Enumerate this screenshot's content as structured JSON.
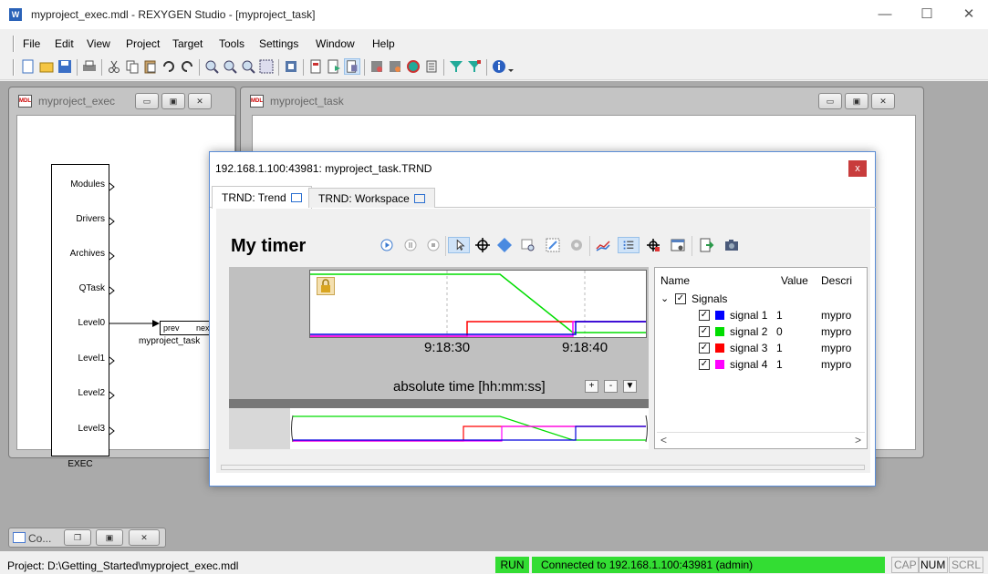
{
  "window": {
    "title": "myproject_exec.mdl - REXYGEN Studio - [myproject_task]",
    "icon_letter": "W",
    "controls": [
      "—",
      "☐",
      "✕"
    ]
  },
  "menubar": [
    "File",
    "Edit",
    "View",
    "Project",
    "Target",
    "Tools",
    "Settings",
    "Window",
    "Help"
  ],
  "toolbar": {
    "icons": [
      "new-file-icon",
      "open-folder-icon",
      "save-icon",
      "print-icon",
      "cut-icon",
      "copy-icon",
      "paste-icon",
      "undo-icon",
      "redo-icon",
      "zoom-in-icon",
      "zoom-out-icon",
      "zoom-fit-icon",
      "zoom-window-icon",
      "compile-icon",
      "block-props-icon",
      "download-icon",
      "watch-icon",
      "diagnostics-icon",
      "connect-icon",
      "settings-icon",
      "list-icon",
      "filter-icon",
      "filter2-icon",
      "info-icon"
    ]
  },
  "children": {
    "exec": {
      "title": "myproject_exec"
    },
    "task": {
      "title": "myproject_task"
    }
  },
  "exec_block": {
    "ports": [
      "Modules",
      "Drivers",
      "Archives",
      "QTask",
      "Level0",
      "Level1",
      "Level2",
      "Level3"
    ],
    "name": "EXEC"
  },
  "task_block": {
    "in_label": "prev",
    "out_label": "next",
    "name": "myproject_task"
  },
  "dialog": {
    "title": "192.168.1.100:43981: myproject_task.TRND",
    "close": "x",
    "tabs": [
      "TRND: Trend",
      "TRND: Workspace"
    ],
    "trend_title": "My timer",
    "tick_labels": [
      "9:18:30",
      "9:18:40"
    ],
    "axis_label": "absolute time [hh:mm:ss]",
    "axis_buttons": [
      "+",
      "-",
      "▼"
    ],
    "signals_panel": {
      "headers": {
        "name": "Name",
        "value": "Value",
        "desc": "Descri"
      },
      "group": "Signals",
      "rows": [
        {
          "name": "signal 1",
          "value": "1",
          "desc": "mypro",
          "color": "#0000ff"
        },
        {
          "name": "signal 2",
          "value": "0",
          "desc": "mypro",
          "color": "#00dd00"
        },
        {
          "name": "signal 3",
          "value": "1",
          "desc": "mypro",
          "color": "#ff0000"
        },
        {
          "name": "signal 4",
          "value": "1",
          "desc": "mypro",
          "color": "#ff00ff"
        }
      ],
      "scroll_left": "<",
      "scroll_right": ">"
    }
  },
  "minimized": {
    "label": "Co..."
  },
  "statusbar": {
    "path": "Project: D:\\Getting_Started\\myproject_exec.mdl",
    "run": "RUN",
    "connection": "Connected to 192.168.1.100:43981 (admin)",
    "indicators": [
      "CAP",
      "NUM",
      "SCRL"
    ]
  }
}
